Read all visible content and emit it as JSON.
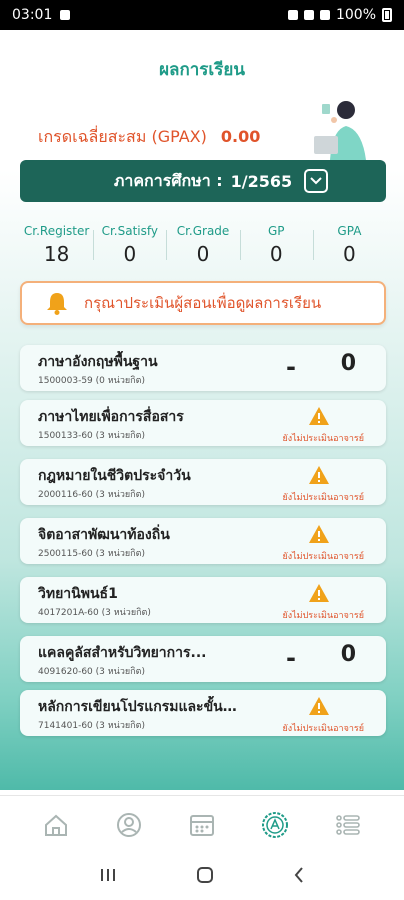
{
  "status_bar": {
    "time": "03:01",
    "battery": "100%"
  },
  "page_title": "ผลการเรียน",
  "gpax": {
    "label": "เกรดเฉลี่ยสะสม (GPAX)",
    "value": "0.00"
  },
  "term": {
    "label": "ภาคการศึกษา :",
    "value": "1/2565"
  },
  "stats": [
    {
      "label": "Cr.Register",
      "value": "18"
    },
    {
      "label": "Cr.Satisfy",
      "value": "0"
    },
    {
      "label": "Cr.Grade",
      "value": "0"
    },
    {
      "label": "GP",
      "value": "0"
    },
    {
      "label": "GPA",
      "value": "0"
    }
  ],
  "alert_text": "กรุณาประเมินผู้สอนเพื่อดูผลการเรียน",
  "courses": [
    {
      "name": "ภาษาอังกฤษพื้นฐาน",
      "code": "1500003-59 (0 หน่วยกิต)",
      "dash": "-",
      "grade": "0",
      "warning": ""
    },
    {
      "name": "ภาษาไทยเพื่อการสื่อสาร",
      "code": "1500133-60 (3 หน่วยกิต)",
      "dash": "",
      "grade": "",
      "warning": "ยังไม่ประเมินอาจารย์"
    },
    {
      "name": "กฎหมายในชีวิตประจำวัน",
      "code": "2000116-60 (3 หน่วยกิต)",
      "dash": "",
      "grade": "",
      "warning": "ยังไม่ประเมินอาจารย์"
    },
    {
      "name": "จิตอาสาพัฒนาท้องถิ่น",
      "code": "2500115-60 (3 หน่วยกิต)",
      "dash": "",
      "grade": "",
      "warning": "ยังไม่ประเมินอาจารย์"
    },
    {
      "name": "วิทยานิพนธ์1",
      "code": "4017201A-60 (3 หน่วยกิต)",
      "dash": "",
      "grade": "",
      "warning": "ยังไม่ประเมินอาจารย์"
    },
    {
      "name": "แคลคูลัสสำหรับวิทยาการ...",
      "code": "4091620-60 (3 หน่วยกิต)",
      "dash": "-",
      "grade": "0",
      "warning": ""
    },
    {
      "name": "หลักการเขียนโปรแกรมและขั้นตอนวิธี",
      "code": "7141401-60 (3 หน่วยกิต)",
      "dash": "",
      "grade": "",
      "warning": "ยังไม่ประเมินอาจารย์"
    }
  ],
  "colors": {
    "primary": "#1d6558",
    "accent_green": "#1f9b88",
    "alert_orange": "#e0542b",
    "warning_yellow": "#f0a21a"
  },
  "bottom_nav_icons": [
    "home-icon",
    "profile-icon",
    "calendar-icon",
    "grade-icon",
    "menu-list-icon"
  ]
}
